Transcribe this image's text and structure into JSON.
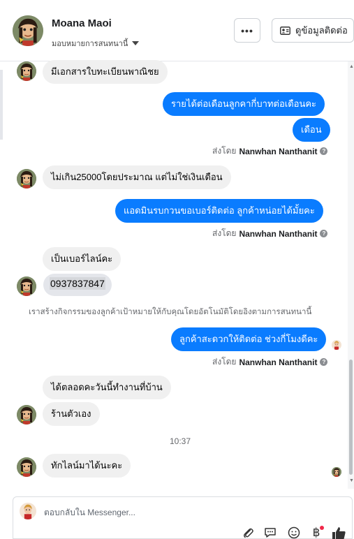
{
  "header": {
    "contact_name": "Moana Maoi",
    "assign_label": "มอบหมายการสนทนานี้",
    "more_label": "•••",
    "contact_info_label": "ดูข้อมูลติดต่อ"
  },
  "messages": [
    {
      "direction": "in",
      "text": "มีเอกสารใบทะเบียนพาณิชย"
    },
    {
      "direction": "out",
      "text": "รายได้ต่อเดือนลูกคากี่บาทต่อเดือนคะ"
    },
    {
      "direction": "out",
      "text": "เดือน"
    },
    {
      "direction": "in",
      "text": "ไม่เกิน25000โดยประมาณ  แต่ไม่ใช่เงินเดือน"
    },
    {
      "direction": "out",
      "text": "แอดมินรบกวนขอเบอร์ติดต่อ ลูกค้าหน่อยได้มั้ยคะ"
    },
    {
      "direction": "in",
      "text": "เป็นเบอร์ไลน์คะ"
    },
    {
      "direction": "in",
      "text": "0937837847"
    },
    {
      "direction": "out",
      "text": "ลูกค้าสะดวกให้ติดต่อ ช่วงกี่โมงดีคะ"
    },
    {
      "direction": "in",
      "text": "ได้ตลอดคะวันนี้ทำงานที่บ้าน"
    },
    {
      "direction": "in",
      "text": "ร้านตัวเอง"
    },
    {
      "direction": "in",
      "text": "ทักไลน์มาได้นะคะ"
    }
  ],
  "sent_by": {
    "prefix": "ส่งโดย",
    "agent_name": "Nanwhan Nanthanit",
    "help_symbol": "?"
  },
  "system_note": "เราสร้างกิจกรรมของลูกค้าเป้าหมายให้กับคุณโดยอัตโนมัติโดยอิงตามการสนทนานี้",
  "timestamp": "10:37",
  "composer": {
    "placeholder": "ตอบกลับใน Messenger..."
  },
  "icons": {
    "more": "more-options-icon",
    "contact_card": "contact-card-icon",
    "attach": "paperclip-icon",
    "saved_reply": "saved-reply-icon",
    "emoji": "emoji-icon",
    "payment": "baht-icon",
    "like": "thumbs-up-icon"
  },
  "colors": {
    "outgoing_bubble": "#0a7cff",
    "incoming_bubble": "#f0f0f0",
    "notification": "#f02849"
  }
}
